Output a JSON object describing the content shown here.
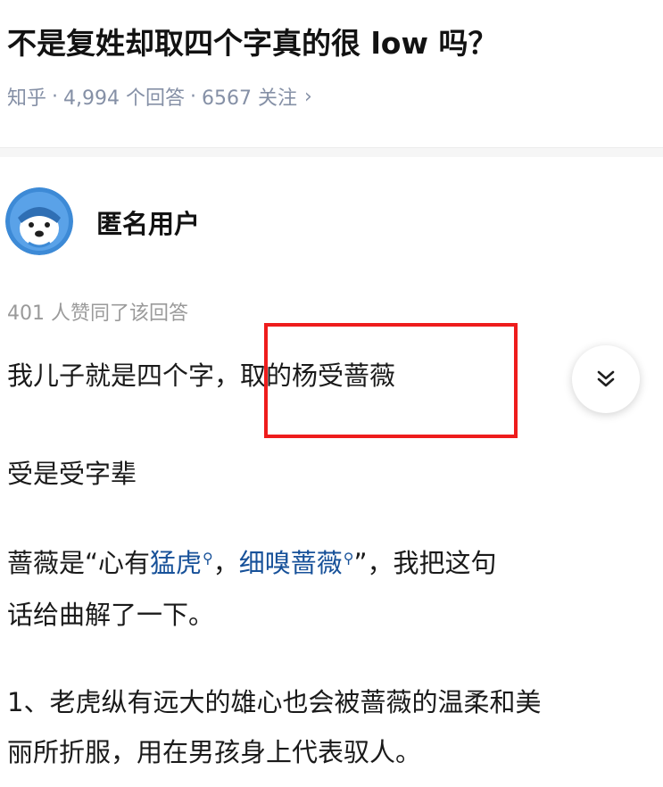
{
  "question": {
    "title": "不是复姓却取四个字真的很 low 吗？",
    "source": "知乎",
    "answers": "4,994 个回答",
    "followers": "6567 关注",
    "chevron": "›"
  },
  "answer": {
    "author": "匿名用户",
    "votes": "401 人赞同了该回答",
    "p1_before": "我儿子就是四个字，",
    "p1_highlight": "取的杨受蔷薇",
    "p2": "受是受字辈",
    "p3_before": "蔷薇是“心有",
    "p3_link1": "猛虎",
    "p3_mid": "，",
    "p3_link2": "细嗅蔷薇",
    "p3_after": "”，我把这句",
    "p3_line2": "话给曲解了一下。",
    "p4_line1": "1、老虎纵有远大的雄心也会被蔷薇的温柔和美",
    "p4_line2": "丽所折服，用在男孩身上代表驭人。"
  },
  "icons": {
    "avatar": "anonymous-avatar-icon",
    "expand": "double-chevron-down-icon",
    "search_mark": "search-icon"
  },
  "colors": {
    "link": "#175199",
    "meta": "#8590a6",
    "highlight_border": "#ee1c1c",
    "avatar_bg": "#3d8ad6"
  }
}
